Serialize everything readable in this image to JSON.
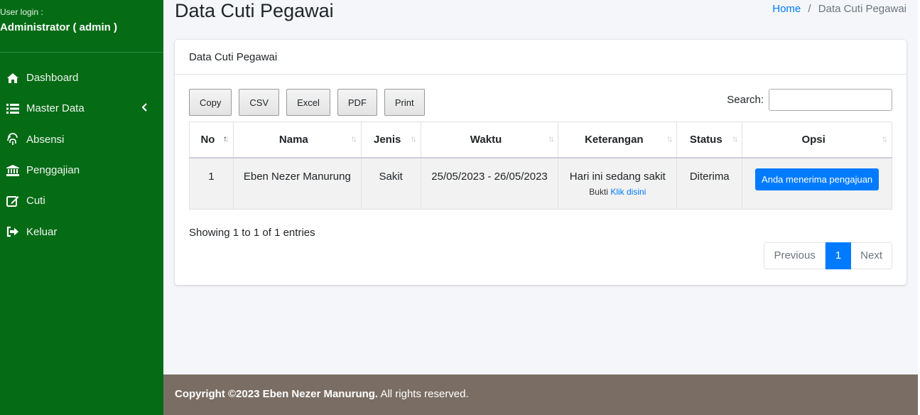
{
  "user": {
    "label": "User login :",
    "name": "Administrator ( admin )"
  },
  "sidebar": {
    "items": [
      {
        "label": "Dashboard",
        "icon": "home-icon"
      },
      {
        "label": "Master Data",
        "icon": "list-icon"
      },
      {
        "label": "Absensi",
        "icon": "fingerprint-icon"
      },
      {
        "label": "Penggajian",
        "icon": "bank-icon"
      },
      {
        "label": "Cuti",
        "icon": "edit-icon"
      },
      {
        "label": "Keluar",
        "icon": "sign-out-icon"
      }
    ]
  },
  "page": {
    "title": "Data Cuti Pegawai"
  },
  "breadcrumb": {
    "home": "Home",
    "separator": "/",
    "current": "Data Cuti Pegawai"
  },
  "card": {
    "title": "Data Cuti Pegawai"
  },
  "toolbar": {
    "copy": "Copy",
    "csv": "CSV",
    "excel": "Excel",
    "pdf": "PDF",
    "print": "Print"
  },
  "search": {
    "label": "Search:",
    "value": ""
  },
  "table": {
    "headers": [
      "No",
      "Nama",
      "Jenis",
      "Waktu",
      "Keterangan",
      "Status",
      "Opsi"
    ],
    "rows": [
      {
        "no": "1",
        "nama": "Eben Nezer Manurung",
        "jenis": "Sakit",
        "waktu": "25/05/2023 - 26/05/2023",
        "keterangan": "Hari ini sedang sakit",
        "bukti_label": "Bukti",
        "bukti_link": "Klik disini",
        "status": "Diterima",
        "opsi": "Anda menerima pengajuan"
      }
    ]
  },
  "info": "Showing 1 to 1 of 1 entries",
  "pagination": {
    "previous": "Previous",
    "page": "1",
    "next": "Next"
  },
  "footer": {
    "bold": "Copyright ©2023 Eben Nezer Manurung.",
    "rest": " All rights reserved."
  },
  "colors": {
    "sidebar": "#056b15",
    "primary": "#007bff",
    "footer": "#7a6e64"
  }
}
